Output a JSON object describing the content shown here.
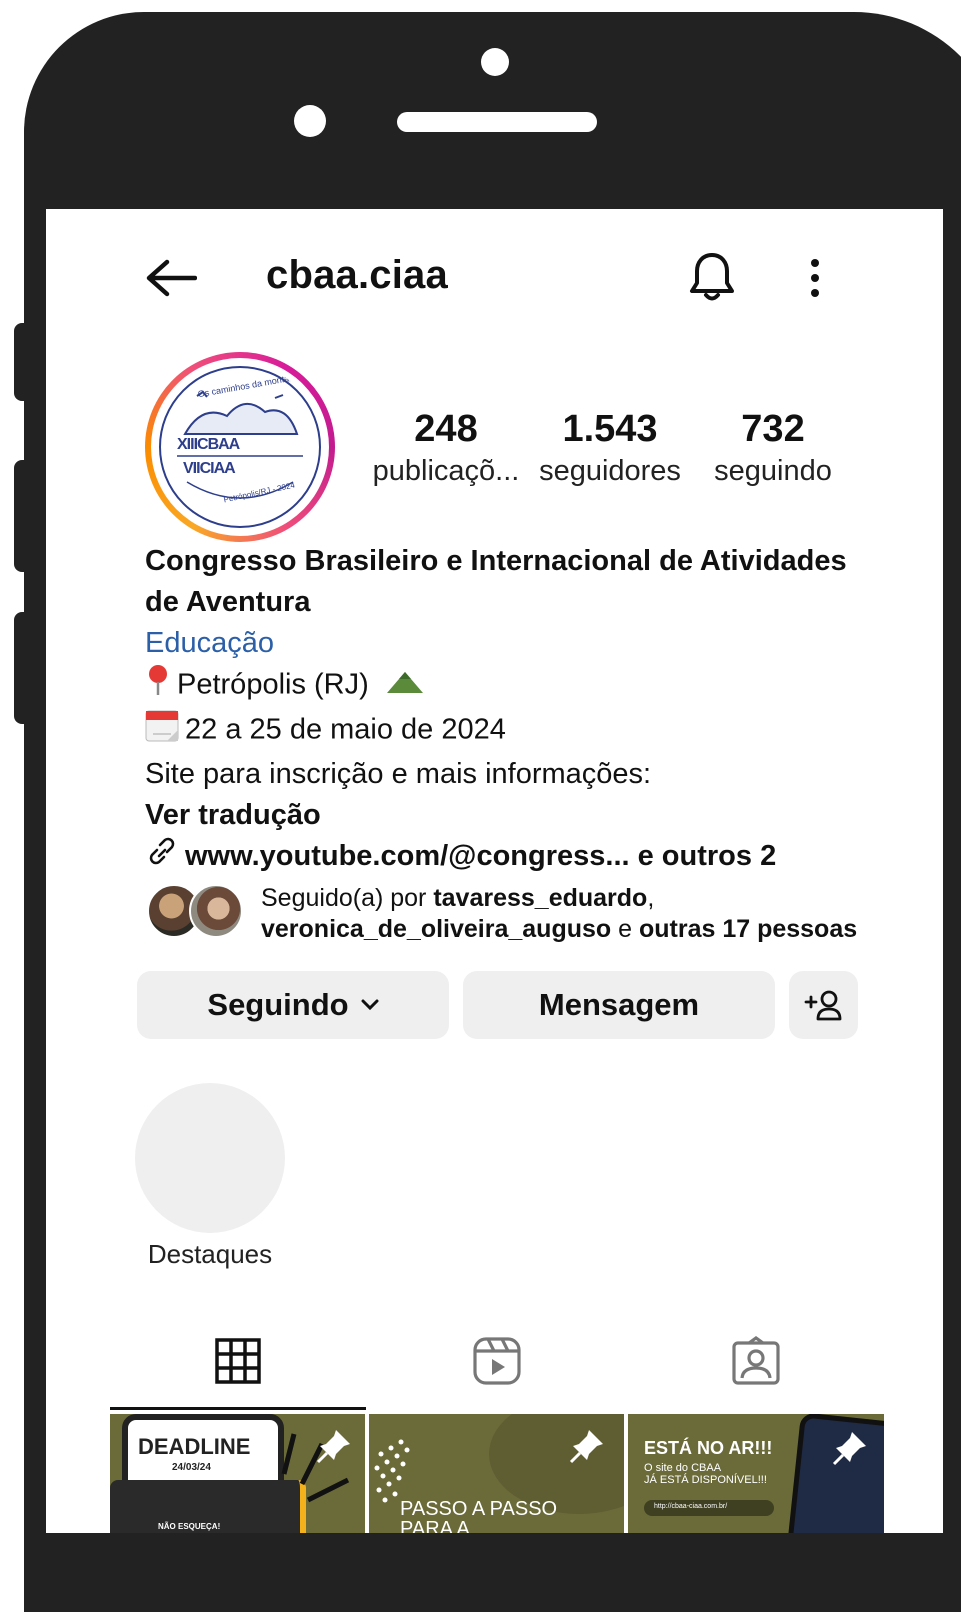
{
  "header": {
    "username": "cbaa.ciaa"
  },
  "stats": [
    {
      "value": "248",
      "label": "publicaçõ..."
    },
    {
      "value": "1.543",
      "label": "seguidores"
    },
    {
      "value": "732",
      "label": "seguindo"
    }
  ],
  "bio": {
    "name_line1": "Congresso Brasileiro e Internacional de Atividades",
    "name_line2": "de Aventura",
    "category": "Educação",
    "location": "Petrópolis (RJ)",
    "dates": "22 a 25 de maio de 2024",
    "site_text": "Site para inscrição e mais informações:",
    "translate": "Ver tradução",
    "link": "www.youtube.com/@congress... e outros 2"
  },
  "followed_by": {
    "prefix": "Seguido(a) por ",
    "user1": "tavaress_eduardo",
    "sep": ",",
    "user2": "veronica_de_oliveira_auguso",
    "mid": " e ",
    "others": "outras 17 pessoas"
  },
  "actions": {
    "following": "Seguindo",
    "message": "Mensagem"
  },
  "highlights": {
    "label": "Destaques"
  },
  "posts": [
    {
      "title": "DEADLINE",
      "date": "24/03/24",
      "caption": "NÃO ESQUEÇA!",
      "pinned": true
    },
    {
      "title": "PASSO A PASSO",
      "subtitle": "PARA A",
      "pinned": true
    },
    {
      "title": "ESTÁ NO AR!!!",
      "subtitle": "O site do CBAA",
      "subtitle2": "JÁ ESTÁ DISPONÍVEL!!!",
      "url": "http://cbaa-ciaa.com.br/",
      "pinned": true
    }
  ],
  "logo": {
    "top_text": "Os caminhos da montanha",
    "row1": "XIIICBAA",
    "row2": "VIICIAA",
    "city": "Petrópolis/RJ - 2024"
  },
  "colors": {
    "category_link": "#2b5fa8",
    "button_bg": "#efefef",
    "post_olive": "#6b6b3a"
  }
}
